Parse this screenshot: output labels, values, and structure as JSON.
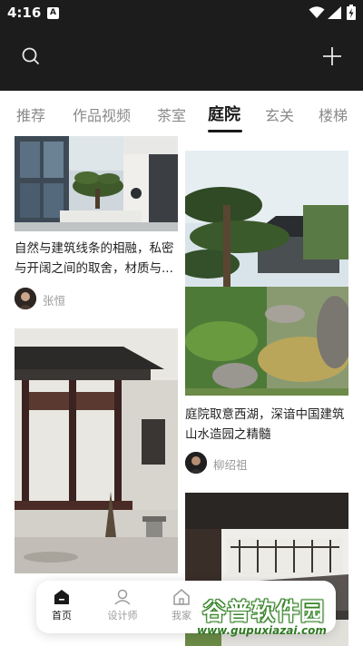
{
  "status_bar": {
    "time": "4:16",
    "app_badge": "A"
  },
  "header": {
    "search_icon": "search-icon",
    "add_icon": "plus-icon"
  },
  "tabs": [
    {
      "label": "推荐"
    },
    {
      "label": "作品视频"
    },
    {
      "label": "茶室"
    },
    {
      "label": "庭院",
      "active": true
    },
    {
      "label": "玄关"
    },
    {
      "label": "楼梯"
    }
  ],
  "feed": {
    "cards": [
      {
        "title": "自然与建筑线条的相融，私密与开阔之间的取舍，材质与...",
        "author": "张恒"
      },
      {
        "title": "庭院取意西湖，深谙中国建筑山水造园之精髓",
        "author": "柳绍祖"
      },
      {
        "title": "",
        "author": ""
      },
      {
        "title": "",
        "author": ""
      }
    ]
  },
  "bottom_nav": [
    {
      "label": "首页",
      "icon": "home-icon",
      "active": true
    },
    {
      "label": "设计师",
      "icon": "designer-icon"
    },
    {
      "label": "我家",
      "icon": "house-icon"
    }
  ],
  "watermark": {
    "main": "谷普软件园",
    "sub": "www.gupuxiazai.com"
  },
  "colors": {
    "header_bg": "#1c1c1c",
    "active_tab": "#1a1a1a",
    "inactive_tab": "#8a8a8a",
    "watermark": "#2f7a22"
  }
}
